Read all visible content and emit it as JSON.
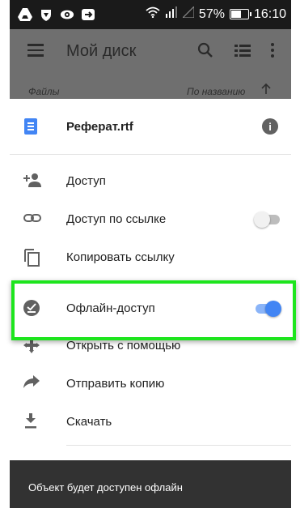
{
  "status_bar": {
    "battery": "57%",
    "time": "16:10",
    "left_icons": [
      "drive-icon",
      "shield-icon",
      "eye-icon",
      "cast-icon"
    ],
    "right_icons": [
      "wifi-icon",
      "signal-icon",
      "signal-empty-icon",
      "battery-icon"
    ]
  },
  "app_bar": {
    "title": "Мой диск",
    "icons": [
      "menu-icon",
      "search-icon",
      "list-view-icon",
      "more-vert-icon"
    ]
  },
  "sort_row": {
    "left_label": "Файлы",
    "right_label": "По названию"
  },
  "file": {
    "name": "Реферат.rtf"
  },
  "menu": {
    "items": [
      {
        "label": "Доступ",
        "icon": "person-add-icon"
      },
      {
        "label": "Доступ по ссылке",
        "icon": "link-icon",
        "toggle": false
      },
      {
        "label": "Копировать ссылку",
        "icon": "copy-icon"
      },
      {
        "label": "Офлайн-доступ",
        "icon": "offline-check-icon",
        "toggle": true
      },
      {
        "label": "Открыть с помощью",
        "icon": "open-with-icon"
      },
      {
        "label": "Отправить копию",
        "icon": "share-arrow-icon"
      },
      {
        "label": "Скачать",
        "icon": "download-icon"
      }
    ]
  },
  "snackbar": {
    "text": "Объект будет доступен офлайн"
  },
  "colors": {
    "accent": "#4285f4",
    "highlight": "#1de51d",
    "scrim": "#6f6f6f",
    "snackbar": "#323232"
  }
}
